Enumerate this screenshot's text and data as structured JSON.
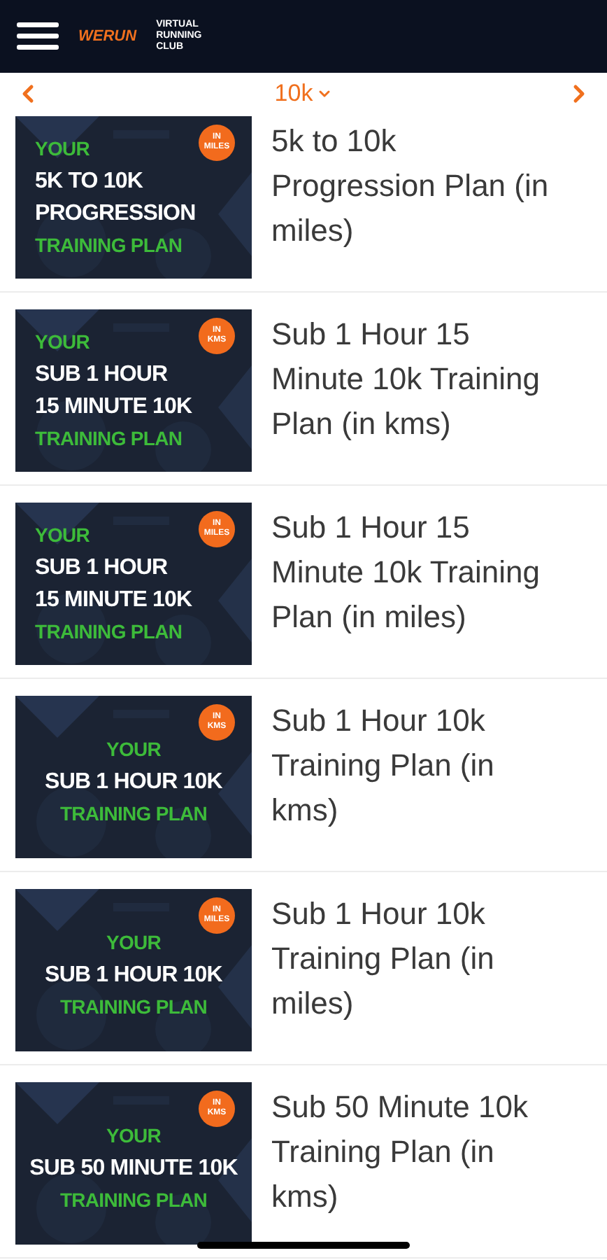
{
  "header": {
    "brand": "WERUN",
    "club": [
      "VIRTUAL",
      "RUNNING",
      "CLUB"
    ]
  },
  "filter": {
    "label": "10k"
  },
  "plans": [
    {
      "thumb": {
        "kind": "left",
        "badge": [
          "IN",
          "MILES"
        ],
        "lines": [
          {
            "text": "YOUR",
            "kind": "accent"
          },
          {
            "text": "5K TO 10K",
            "kind": "main"
          },
          {
            "text": "PROGRESSION",
            "kind": "main"
          },
          {
            "text": "TRAINING PLAN",
            "kind": "accent"
          }
        ]
      },
      "title": [
        "5k to 10k",
        "Progression Plan (in",
        "miles)"
      ]
    },
    {
      "thumb": {
        "kind": "left",
        "badge": [
          "IN",
          "KMS"
        ],
        "lines": [
          {
            "text": "YOUR",
            "kind": "accent"
          },
          {
            "text": "SUB 1 HOUR",
            "kind": "main"
          },
          {
            "text": "15 MINUTE 10K",
            "kind": "main"
          },
          {
            "text": "TRAINING PLAN",
            "kind": "accent"
          }
        ]
      },
      "title": [
        "Sub 1 Hour 15",
        "Minute 10k Training",
        "Plan (in kms)"
      ]
    },
    {
      "thumb": {
        "kind": "left",
        "badge": [
          "IN",
          "MILES"
        ],
        "lines": [
          {
            "text": "YOUR",
            "kind": "accent"
          },
          {
            "text": "SUB 1 HOUR",
            "kind": "main"
          },
          {
            "text": "15 MINUTE 10K",
            "kind": "main"
          },
          {
            "text": "TRAINING PLAN",
            "kind": "accent"
          }
        ]
      },
      "title": [
        "Sub 1 Hour 15",
        "Minute 10k Training",
        "Plan (in miles)"
      ]
    },
    {
      "thumb": {
        "kind": "center",
        "badge": [
          "IN",
          "KMS"
        ],
        "lines": [
          {
            "text": "YOUR",
            "kind": "accent"
          },
          {
            "text": "SUB 1 HOUR 10K",
            "kind": "main"
          },
          {
            "text": "TRAINING PLAN",
            "kind": "accent"
          }
        ]
      },
      "title": [
        "Sub 1 Hour 10k",
        "Training Plan (in",
        "kms)"
      ]
    },
    {
      "thumb": {
        "kind": "center",
        "badge": [
          "IN",
          "MILES"
        ],
        "lines": [
          {
            "text": "YOUR",
            "kind": "accent"
          },
          {
            "text": "SUB 1 HOUR 10K",
            "kind": "main"
          },
          {
            "text": "TRAINING PLAN",
            "kind": "accent"
          }
        ]
      },
      "title": [
        "Sub 1 Hour 10k",
        "Training Plan (in",
        "miles)"
      ]
    },
    {
      "thumb": {
        "kind": "center",
        "badge": [
          "IN",
          "KMS"
        ],
        "lines": [
          {
            "text": "YOUR",
            "kind": "accent"
          },
          {
            "text": "SUB 50 MINUTE 10K",
            "kind": "main"
          },
          {
            "text": "TRAINING PLAN",
            "kind": "accent"
          }
        ]
      },
      "title": [
        "Sub 50 Minute 10k",
        "Training Plan (in",
        "kms)"
      ]
    }
  ]
}
